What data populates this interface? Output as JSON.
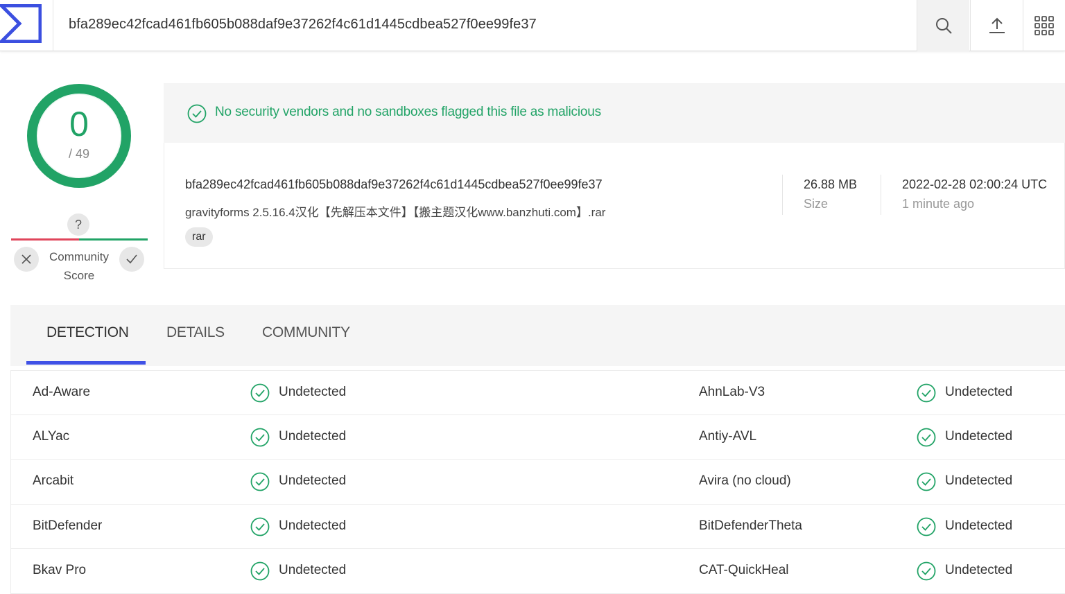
{
  "header": {
    "search_value": "bfa289ec42fcad461fb605b088daf9e37262f4c61d1445cdbea527f0ee99fe37",
    "icons": [
      "virustotal-logo",
      "search-icon",
      "upload-icon",
      "apps-grid-icon"
    ]
  },
  "score": {
    "detections": "0",
    "total": "/ 49",
    "community_question": "?",
    "community_label": "Community Score"
  },
  "verdict": {
    "text": "No security vendors and no sandboxes flagged this file as malicious",
    "color": "#21a366"
  },
  "file": {
    "hash": "bfa289ec42fcad461fb605b088daf9e37262f4c61d1445cdbea527f0ee99fe37",
    "name": "gravityforms 2.5.16.4汉化【先解压本文件】【搬主题汉化www.banzhuti.com】.rar",
    "tag": "rar",
    "size_value": "26.88 MB",
    "size_label": "Size",
    "date_value": "2022-02-28 02:00:24 UTC",
    "date_label": "1 minute ago"
  },
  "tabs": [
    {
      "label": "DETECTION",
      "active": true
    },
    {
      "label": "DETAILS",
      "active": false
    },
    {
      "label": "COMMUNITY",
      "active": false
    }
  ],
  "accent": "#3f51e6",
  "detections": [
    {
      "left_vendor": "Ad-Aware",
      "left_result": "Undetected",
      "right_vendor": "AhnLab-V3",
      "right_result": "Undetected"
    },
    {
      "left_vendor": "ALYac",
      "left_result": "Undetected",
      "right_vendor": "Antiy-AVL",
      "right_result": "Undetected"
    },
    {
      "left_vendor": "Arcabit",
      "left_result": "Undetected",
      "right_vendor": "Avira (no cloud)",
      "right_result": "Undetected"
    },
    {
      "left_vendor": "BitDefender",
      "left_result": "Undetected",
      "right_vendor": "BitDefenderTheta",
      "right_result": "Undetected"
    },
    {
      "left_vendor": "Bkav Pro",
      "left_result": "Undetected",
      "right_vendor": "CAT-QuickHeal",
      "right_result": "Undetected"
    }
  ]
}
